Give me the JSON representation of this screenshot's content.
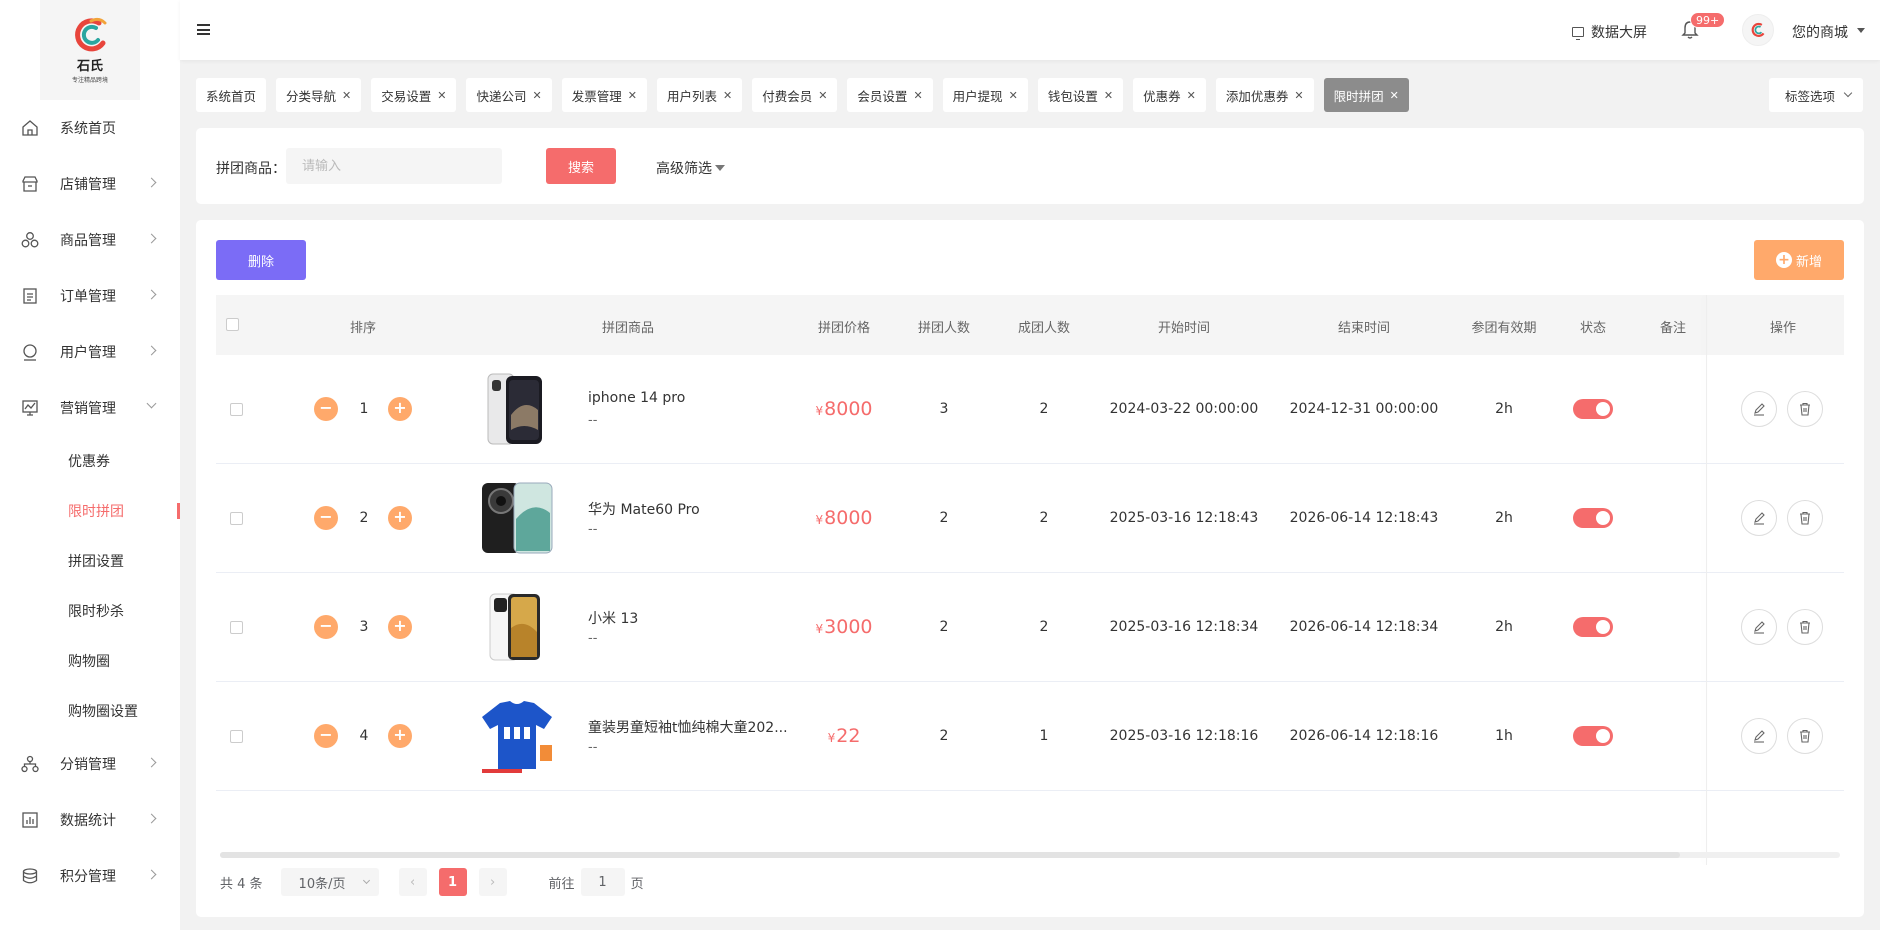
{
  "logo": {
    "title": "石氏",
    "subtitle": "专注精品跨境"
  },
  "sidebar": {
    "items": [
      {
        "label": "系统首页",
        "icon": "home-icon",
        "arrow": false
      },
      {
        "label": "店铺管理",
        "icon": "store-icon",
        "arrow": true
      },
      {
        "label": "商品管理",
        "icon": "goods-icon",
        "arrow": true
      },
      {
        "label": "订单管理",
        "icon": "order-icon",
        "arrow": true
      },
      {
        "label": "用户管理",
        "icon": "user-icon",
        "arrow": true
      },
      {
        "label": "营销管理",
        "icon": "marketing-icon",
        "arrow": true,
        "expanded": true
      }
    ],
    "sub_items": [
      {
        "label": "优惠券"
      },
      {
        "label": "限时拼团",
        "active": true
      },
      {
        "label": "拼团设置"
      },
      {
        "label": "限时秒杀"
      },
      {
        "label": "购物圈"
      },
      {
        "label": "购物圈设置"
      }
    ],
    "items_after": [
      {
        "label": "分销管理",
        "icon": "distribution-icon"
      },
      {
        "label": "数据统计",
        "icon": "chart-icon"
      },
      {
        "label": "积分管理",
        "icon": "points-icon"
      }
    ]
  },
  "header": {
    "data_screen": "数据大屏",
    "badge": "99+",
    "shop_name": "您的商城"
  },
  "tags": [
    {
      "label": "系统首页",
      "closable": false
    },
    {
      "label": "分类导航",
      "closable": true
    },
    {
      "label": "交易设置",
      "closable": true
    },
    {
      "label": "快递公司",
      "closable": true
    },
    {
      "label": "发票管理",
      "closable": true
    },
    {
      "label": "用户列表",
      "closable": true
    },
    {
      "label": "付费会员",
      "closable": true
    },
    {
      "label": "会员设置",
      "closable": true
    },
    {
      "label": "用户提现",
      "closable": true
    },
    {
      "label": "钱包设置",
      "closable": true
    },
    {
      "label": "优惠券",
      "closable": true
    },
    {
      "label": "添加优惠券",
      "closable": true
    },
    {
      "label": "限时拼团",
      "closable": true,
      "active": true
    }
  ],
  "tag_options": "标签选项",
  "search": {
    "label": "拼团商品：",
    "placeholder": "请输入",
    "button": "搜索",
    "advanced": "高级筛选"
  },
  "actions": {
    "delete": "删除",
    "add": "新增"
  },
  "table": {
    "columns": [
      "排序",
      "拼团商品",
      "拼团价格",
      "拼团人数",
      "成团人数",
      "开始时间",
      "结束时间",
      "参团有效期",
      "状态",
      "备注",
      "操作"
    ],
    "rows": [
      {
        "sort": "1",
        "name": "iphone 14 pro",
        "sub": "--",
        "currency": "¥",
        "price": "8000",
        "group_size": "3",
        "formed": "2",
        "start": "2024-03-22 00:00:00",
        "end": "2024-12-31 00:00:00",
        "validity": "2h",
        "status": true,
        "remark": "",
        "image": "iphone-image"
      },
      {
        "sort": "2",
        "name": "华为 Mate60 Pro",
        "sub": "--",
        "currency": "¥",
        "price": "8000",
        "group_size": "2",
        "formed": "2",
        "start": "2025-03-16 12:18:43",
        "end": "2026-06-14 12:18:43",
        "validity": "2h",
        "status": true,
        "remark": "",
        "image": "huawei-image"
      },
      {
        "sort": "3",
        "name": "小米 13",
        "sub": "--",
        "currency": "¥",
        "price": "3000",
        "group_size": "2",
        "formed": "2",
        "start": "2025-03-16 12:18:34",
        "end": "2026-06-14 12:18:34",
        "validity": "2h",
        "status": true,
        "remark": "",
        "image": "xiaomi-image"
      },
      {
        "sort": "4",
        "name": "童装男童短袖t恤纯棉大童202...",
        "sub": "--",
        "currency": "¥",
        "price": "22",
        "group_size": "2",
        "formed": "1",
        "start": "2025-03-16 12:18:16",
        "end": "2026-06-14 12:18:16",
        "validity": "1h",
        "status": true,
        "remark": "",
        "image": "tshirt-image"
      }
    ]
  },
  "pagination": {
    "total": "共 4 条",
    "page_size": "10条/页",
    "current": "1",
    "goto_prefix": "前往",
    "goto_value": "1",
    "goto_suffix": "页"
  },
  "colors": {
    "accent": "#f56c6c",
    "purple": "#7b6cf6",
    "orange": "#ffa96b"
  }
}
